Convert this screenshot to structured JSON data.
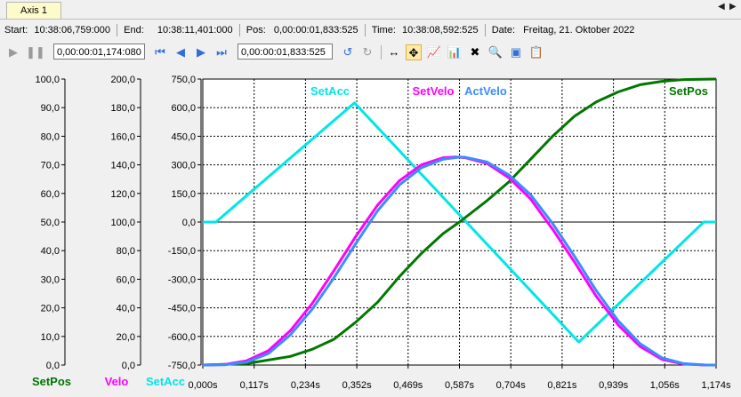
{
  "tab": {
    "label": "Axis 1",
    "nav_left": "◀",
    "nav_right": "▶"
  },
  "info": {
    "start_label": "Start:",
    "start_value": "10:38:06,759:000",
    "end_label": "End:",
    "end_value": "10:38:11,401:000",
    "pos_label": "Pos:",
    "pos_value": "0,00:00:01,833:525",
    "time_label": "Time:",
    "time_value": "10:38:08,592:525",
    "date_label": "Date:",
    "date_value": "Freitag, 21. Oktober 2022"
  },
  "toolbar": {
    "range_value": "0,00:00:01,174:080",
    "position_value": "0,00:00:01,833:525"
  },
  "colors": {
    "SetPos": "#007800",
    "SetVelo": "#ff00ff",
    "ActVelo": "#3c8cff",
    "SetAcc": "#00e6e6"
  },
  "chart_data": {
    "type": "line",
    "x_unit": "s",
    "x_ticks": [
      "0,000s",
      "0,117s",
      "0,234s",
      "0,352s",
      "0,469s",
      "0,587s",
      "0,704s",
      "0,821s",
      "0,939s",
      "1,056s",
      "1,174s"
    ],
    "xlim": [
      0,
      1.174
    ],
    "axes": [
      {
        "name": "SetPos",
        "ylim": [
          0,
          100
        ],
        "ticks": [
          "100,0",
          "90,0",
          "80,0",
          "70,0",
          "60,0",
          "50,0",
          "40,0",
          "30,0",
          "20,0",
          "10,0",
          "0,0"
        ]
      },
      {
        "name": "Velo",
        "ylim": [
          0,
          200
        ],
        "ticks": [
          "200,0",
          "180,0",
          "160,0",
          "140,0",
          "120,0",
          "100,0",
          "80,0",
          "60,0",
          "40,0",
          "20,0",
          "0,0"
        ]
      },
      {
        "name": "SetAcc",
        "ylim": [
          -750,
          750
        ],
        "ticks": [
          "750,0",
          "600,0",
          "450,0",
          "300,0",
          "150,0",
          "0,0",
          "-150,0",
          "-300,0",
          "-450,0",
          "-600,0",
          "-750,0"
        ]
      }
    ],
    "series": [
      {
        "name": "SetAcc",
        "axis": "SetAcc",
        "x": [
          0,
          0.03,
          0.347,
          0.86,
          1.146,
          1.174
        ],
        "y": [
          0,
          0,
          625,
          -630,
          0,
          0
        ]
      },
      {
        "name": "SetVelo",
        "axis": "Velo",
        "x": [
          0,
          0.05,
          0.1,
          0.15,
          0.2,
          0.25,
          0.3,
          0.35,
          0.4,
          0.45,
          0.5,
          0.55,
          0.58,
          0.6,
          0.65,
          0.7,
          0.75,
          0.8,
          0.85,
          0.9,
          0.95,
          1.0,
          1.05,
          1.1,
          1.15,
          1.174
        ],
        "y": [
          0,
          0.4,
          3,
          10,
          24,
          43,
          66,
          90,
          112,
          129,
          140,
          145,
          145.5,
          145,
          141,
          131,
          116,
          95,
          72,
          48,
          28,
          13,
          4,
          0.7,
          0,
          0
        ]
      },
      {
        "name": "ActVelo",
        "axis": "Velo",
        "x": [
          0,
          0.05,
          0.1,
          0.15,
          0.2,
          0.25,
          0.3,
          0.35,
          0.4,
          0.45,
          0.5,
          0.55,
          0.59,
          0.6,
          0.65,
          0.7,
          0.75,
          0.8,
          0.85,
          0.9,
          0.95,
          1.0,
          1.05,
          1.1,
          1.15,
          1.174
        ],
        "y": [
          0,
          0.2,
          2,
          8,
          21,
          39,
          61,
          85,
          108,
          126,
          138,
          144,
          145.5,
          145.3,
          142,
          133,
          119,
          99,
          76,
          52,
          31,
          15,
          5,
          1,
          0,
          0
        ]
      },
      {
        "name": "SetPos",
        "axis": "SetPos",
        "x": [
          0,
          0.1,
          0.2,
          0.25,
          0.3,
          0.35,
          0.4,
          0.45,
          0.5,
          0.55,
          0.587,
          0.65,
          0.7,
          0.75,
          0.8,
          0.85,
          0.9,
          0.95,
          1.0,
          1.05,
          1.1,
          1.174
        ],
        "y": [
          0,
          0.5,
          3,
          5.5,
          9,
          15,
          22,
          31,
          39,
          46,
          50,
          57.5,
          64,
          72,
          80,
          87,
          92,
          95.5,
          98,
          99.2,
          99.8,
          100
        ]
      }
    ],
    "labels": {
      "SetAcc": "SetAcc",
      "SetVelo": "SetVelo",
      "ActVelo": "ActVelo",
      "SetPos": "SetPos"
    },
    "axis_titles": {
      "pos": "SetPos",
      "velo": "Velo",
      "acc": "SetAcc"
    },
    "grid": true
  }
}
